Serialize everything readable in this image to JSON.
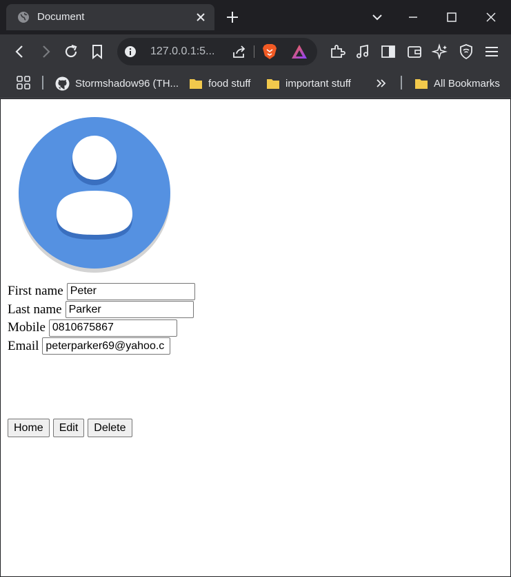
{
  "browser": {
    "tab_title": "Document",
    "url": "127.0.0.1:5...",
    "bookmarks": [
      {
        "label": "Stormshadow96 (TH...",
        "icon": "github-icon"
      },
      {
        "label": "food stuff",
        "icon": "folder-icon"
      },
      {
        "label": "important stuff",
        "icon": "folder-icon"
      },
      {
        "label": "All Bookmarks",
        "icon": "folder-icon"
      }
    ],
    "colors": {
      "chrome_dark": "#1f1f23",
      "chrome": "#35363a",
      "folder": "#f2c94c",
      "avatar_blue": "#5591e1"
    }
  },
  "form": {
    "first_name_label": "First name",
    "first_name_value": "Peter",
    "last_name_label": "Last name",
    "last_name_value": "Parker",
    "mobile_label": "Mobile",
    "mobile_value": "0810675867",
    "email_label": "Email",
    "email_value": "peterparker69@yahoo.c"
  },
  "buttons": {
    "home": "Home",
    "edit": "Edit",
    "delete": "Delete"
  }
}
